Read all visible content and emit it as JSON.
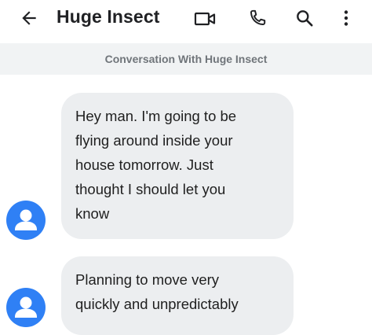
{
  "header": {
    "title": "Huge Insect",
    "back_icon": "arrow-left-icon",
    "video_icon": "video-camera-icon",
    "phone_icon": "phone-icon",
    "search_icon": "search-icon",
    "more_icon": "more-vertical-icon"
  },
  "banner": {
    "text": "Conversation With Huge Insect"
  },
  "messages": [
    {
      "text": "Hey man. I'm going to be\nflying around inside your\nhouse tomorrow. Just\nthought I should let you\nknow",
      "avatar_icon": "person-icon"
    },
    {
      "text": "Planning to move very\nquickly and unpredictably",
      "avatar_icon": "person-icon"
    }
  ],
  "colors": {
    "avatar": "#2f80f5",
    "bubble": "#eceef0",
    "banner": "#f1f3f4"
  }
}
